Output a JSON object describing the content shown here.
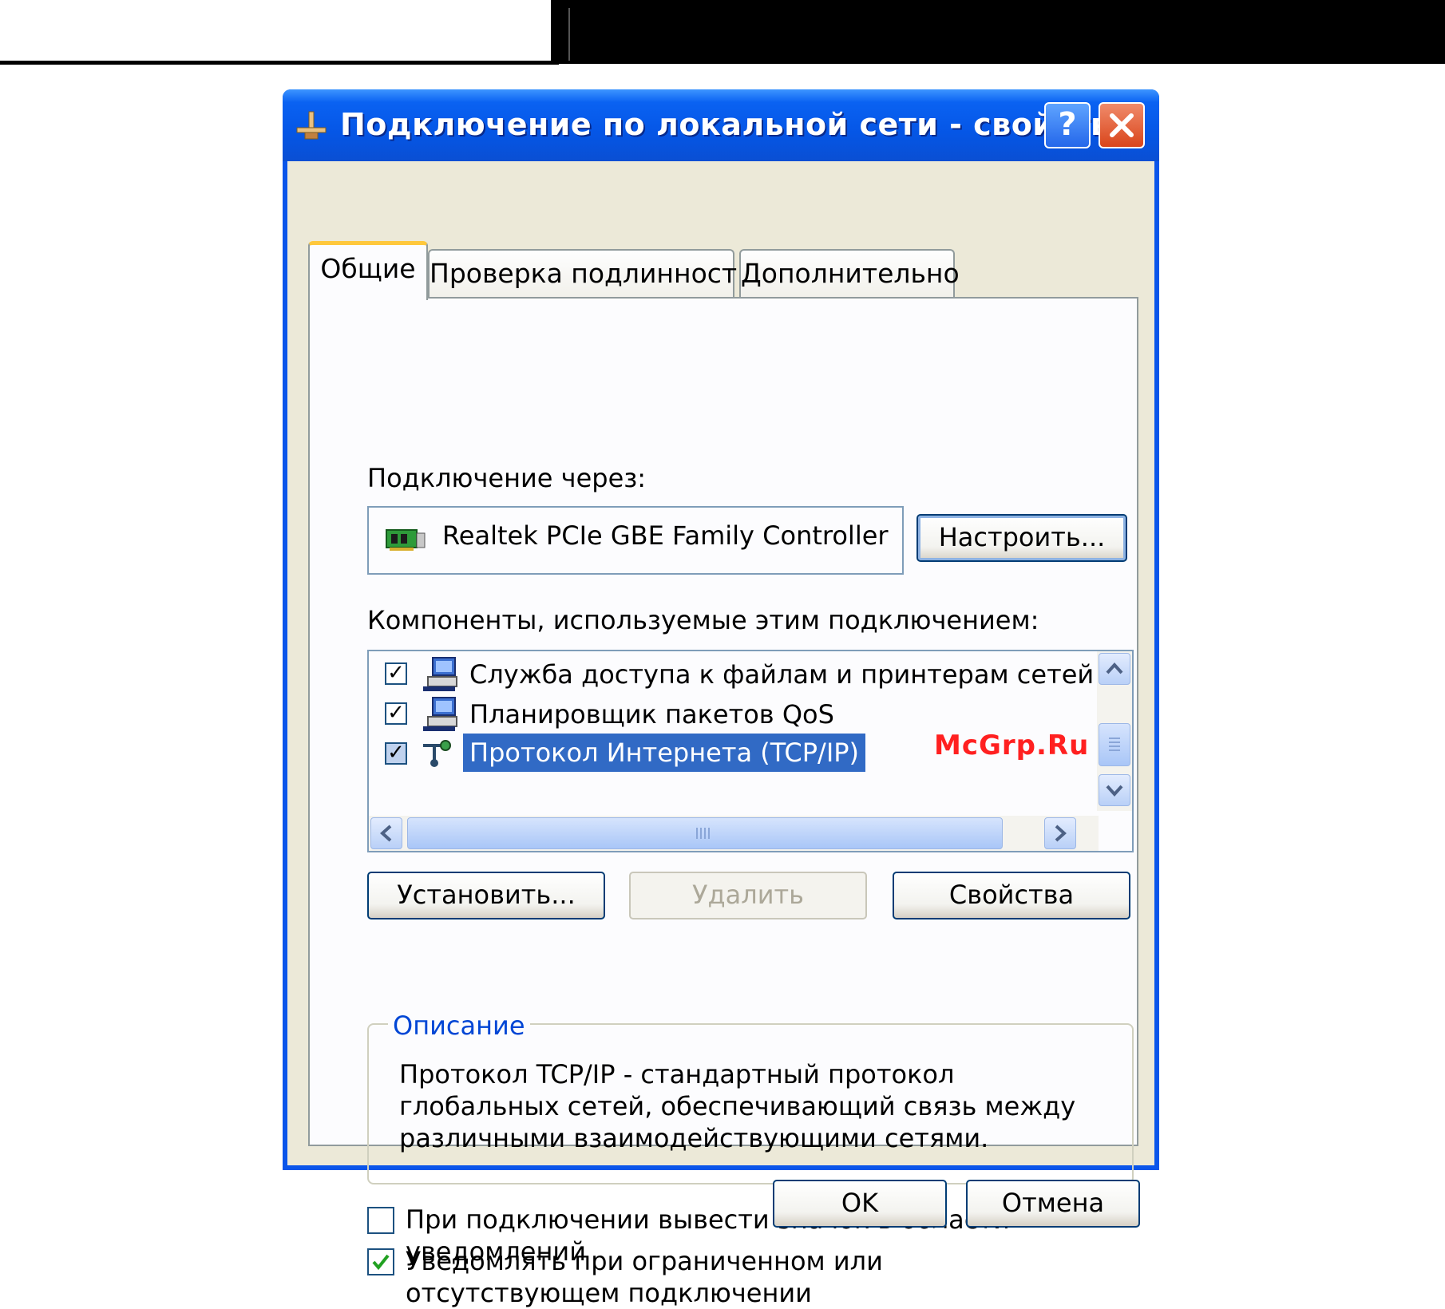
{
  "window": {
    "title": "Подключение по локальной сети - свойства",
    "help_label": "?"
  },
  "tabs": [
    {
      "label": "Общие",
      "active": true
    },
    {
      "label": "Проверка подлинности",
      "active": false
    },
    {
      "label": "Дополнительно",
      "active": false
    }
  ],
  "connect_via": {
    "label": "Подключение через:",
    "adapter": "Realtek PCIe GBE Family Controller",
    "configure_button": "Настроить..."
  },
  "components": {
    "label": "Компоненты, используемые этим подключением:",
    "items": [
      {
        "label": "Служба доступа к файлам и принтерам сетей Micro",
        "checked": true,
        "selected": false,
        "icon": "network-computer-icon"
      },
      {
        "label": "Планировщик пакетов QoS",
        "checked": true,
        "selected": false,
        "icon": "network-computer-icon"
      },
      {
        "label": "Протокол Интернета (TCP/IP)",
        "checked": true,
        "selected": true,
        "icon": "protocol-icon"
      }
    ],
    "install_button": "Установить...",
    "remove_button": "Удалить",
    "properties_button": "Свойства"
  },
  "description": {
    "title": "Описание",
    "text": "Протокол TCP/IP - стандартный протокол глобальных сетей, обеспечивающий связь между различными взаимодействующими сетями."
  },
  "options": {
    "show_icon": {
      "label": "При подключении вывести значок в области уведомлений",
      "checked": false
    },
    "notify": {
      "label": "Уведомлять при ограниченном или отсутствующем подключении",
      "checked": true
    }
  },
  "footer": {
    "ok_button": "OK",
    "cancel_button": "Отмена"
  },
  "watermark": "McGrp.Ru",
  "colors": {
    "titlebar": "#0556e6",
    "selection": "#316ac5",
    "group_title": "#0046d5",
    "watermark": "#ff2020"
  }
}
